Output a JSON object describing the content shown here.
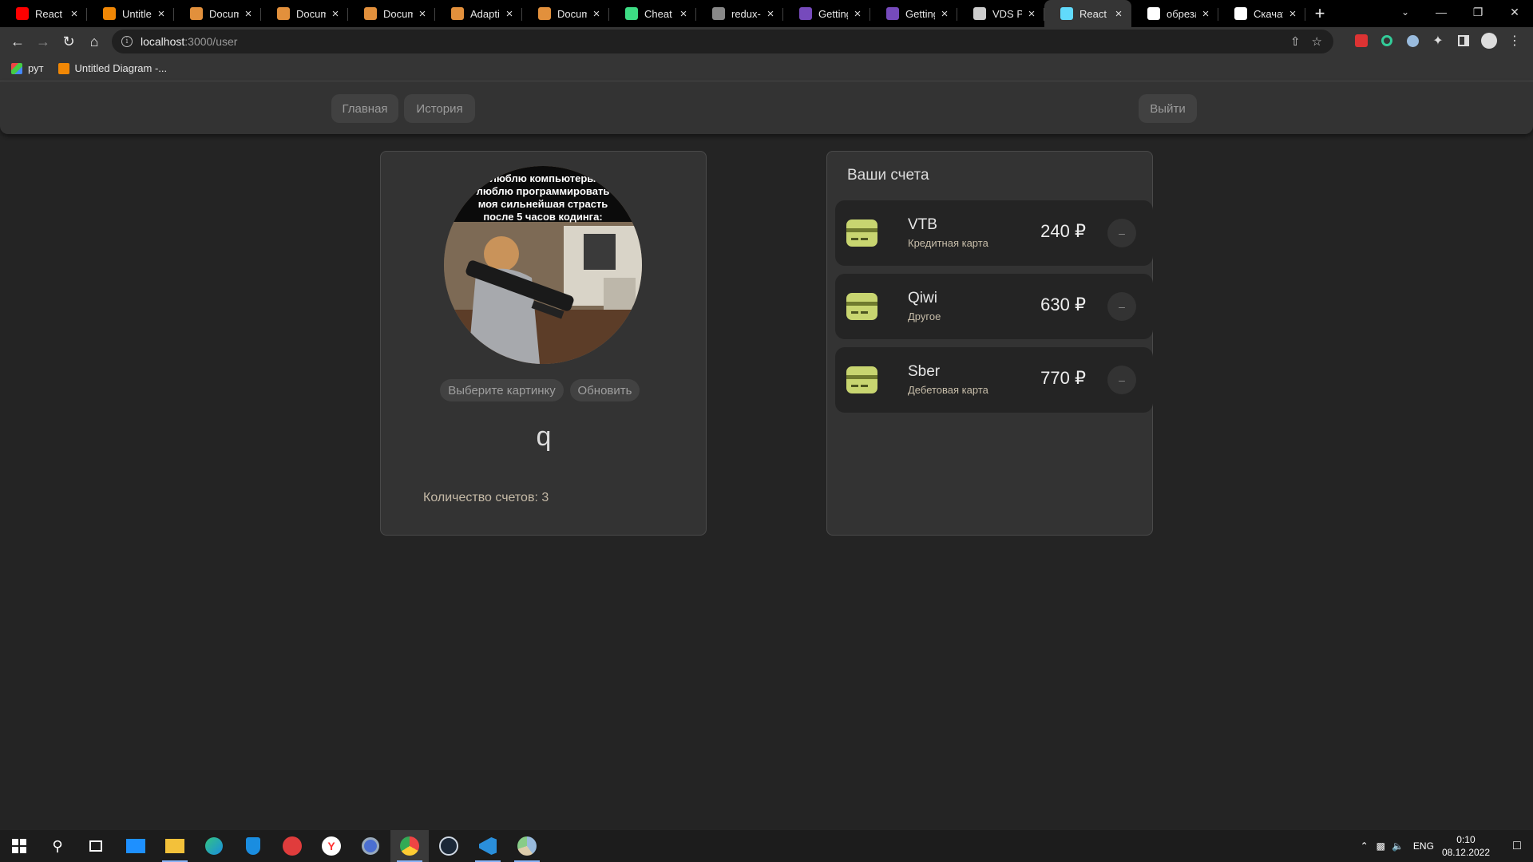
{
  "browser": {
    "tabs": [
      {
        "title": "React Re",
        "icon": "youtube-icon",
        "color": "#ff0000"
      },
      {
        "title": "Untitled",
        "icon": "drawio-icon",
        "color": "#f08705"
      },
      {
        "title": "Docume",
        "icon": "document-icon",
        "color": "#e2903c"
      },
      {
        "title": "Docume",
        "icon": "document-icon",
        "color": "#e2903c"
      },
      {
        "title": "Docume",
        "icon": "document-icon",
        "color": "#e2903c"
      },
      {
        "title": "Adaptive",
        "icon": "document-icon",
        "color": "#e2903c"
      },
      {
        "title": "Docume",
        "icon": "document-icon",
        "color": "#e2903c"
      },
      {
        "title": "Cheat Sh",
        "icon": "shield-icon",
        "color": "#3ddc84"
      },
      {
        "title": "redux-d",
        "icon": "github-icon",
        "color": "#888888"
      },
      {
        "title": "Getting",
        "icon": "redux-icon",
        "color": "#764abc"
      },
      {
        "title": "Getting",
        "icon": "redux-icon",
        "color": "#764abc"
      },
      {
        "title": "VDS Pan",
        "icon": "hexagon-icon",
        "color": "#cccccc"
      },
      {
        "title": "React Ap",
        "icon": "react-icon",
        "color": "#61dafb",
        "active": true
      },
      {
        "title": "обрезат",
        "icon": "google-icon",
        "color": "#ffffff"
      },
      {
        "title": "Скачать",
        "icon": "globe-icon",
        "color": "#ffffff"
      }
    ],
    "address": {
      "host": "localhost",
      "path": ":3000/user"
    },
    "bookmarks": [
      {
        "label": "рут",
        "icon": "puzzle-colored-icon"
      },
      {
        "label": "Untitled Diagram -...",
        "icon": "drawio-icon"
      }
    ]
  },
  "app": {
    "nav": {
      "home": "Главная",
      "history": "История",
      "logout": "Выйти"
    },
    "profile": {
      "avatar_caption_lines": [
        "люблю компьютеры",
        "люблю программировать",
        "моя сильнейшая страсть",
        "после 5 часов кодинга:"
      ],
      "choose_picture": "Выберите картинку",
      "update": "Обновить",
      "username": "q",
      "accounts_count": "Количество счетов: 3"
    },
    "accounts": {
      "title": "Ваши счета",
      "items": [
        {
          "name": "VTB",
          "type": "Кредитная карта",
          "amount": "240 ₽",
          "remove": "–"
        },
        {
          "name": "Qiwi",
          "type": "Другое",
          "amount": "630 ₽",
          "remove": "–"
        },
        {
          "name": "Sber",
          "type": "Дебетовая карта",
          "amount": "770 ₽",
          "remove": "–"
        }
      ]
    }
  },
  "taskbar": {
    "lang": "ENG",
    "time": "0:10",
    "date": "08.12.2022"
  },
  "colors": {
    "card_icon": "#c8d570",
    "card_band": "#6f7a2e",
    "accent_blue": "#8ab4f8"
  }
}
